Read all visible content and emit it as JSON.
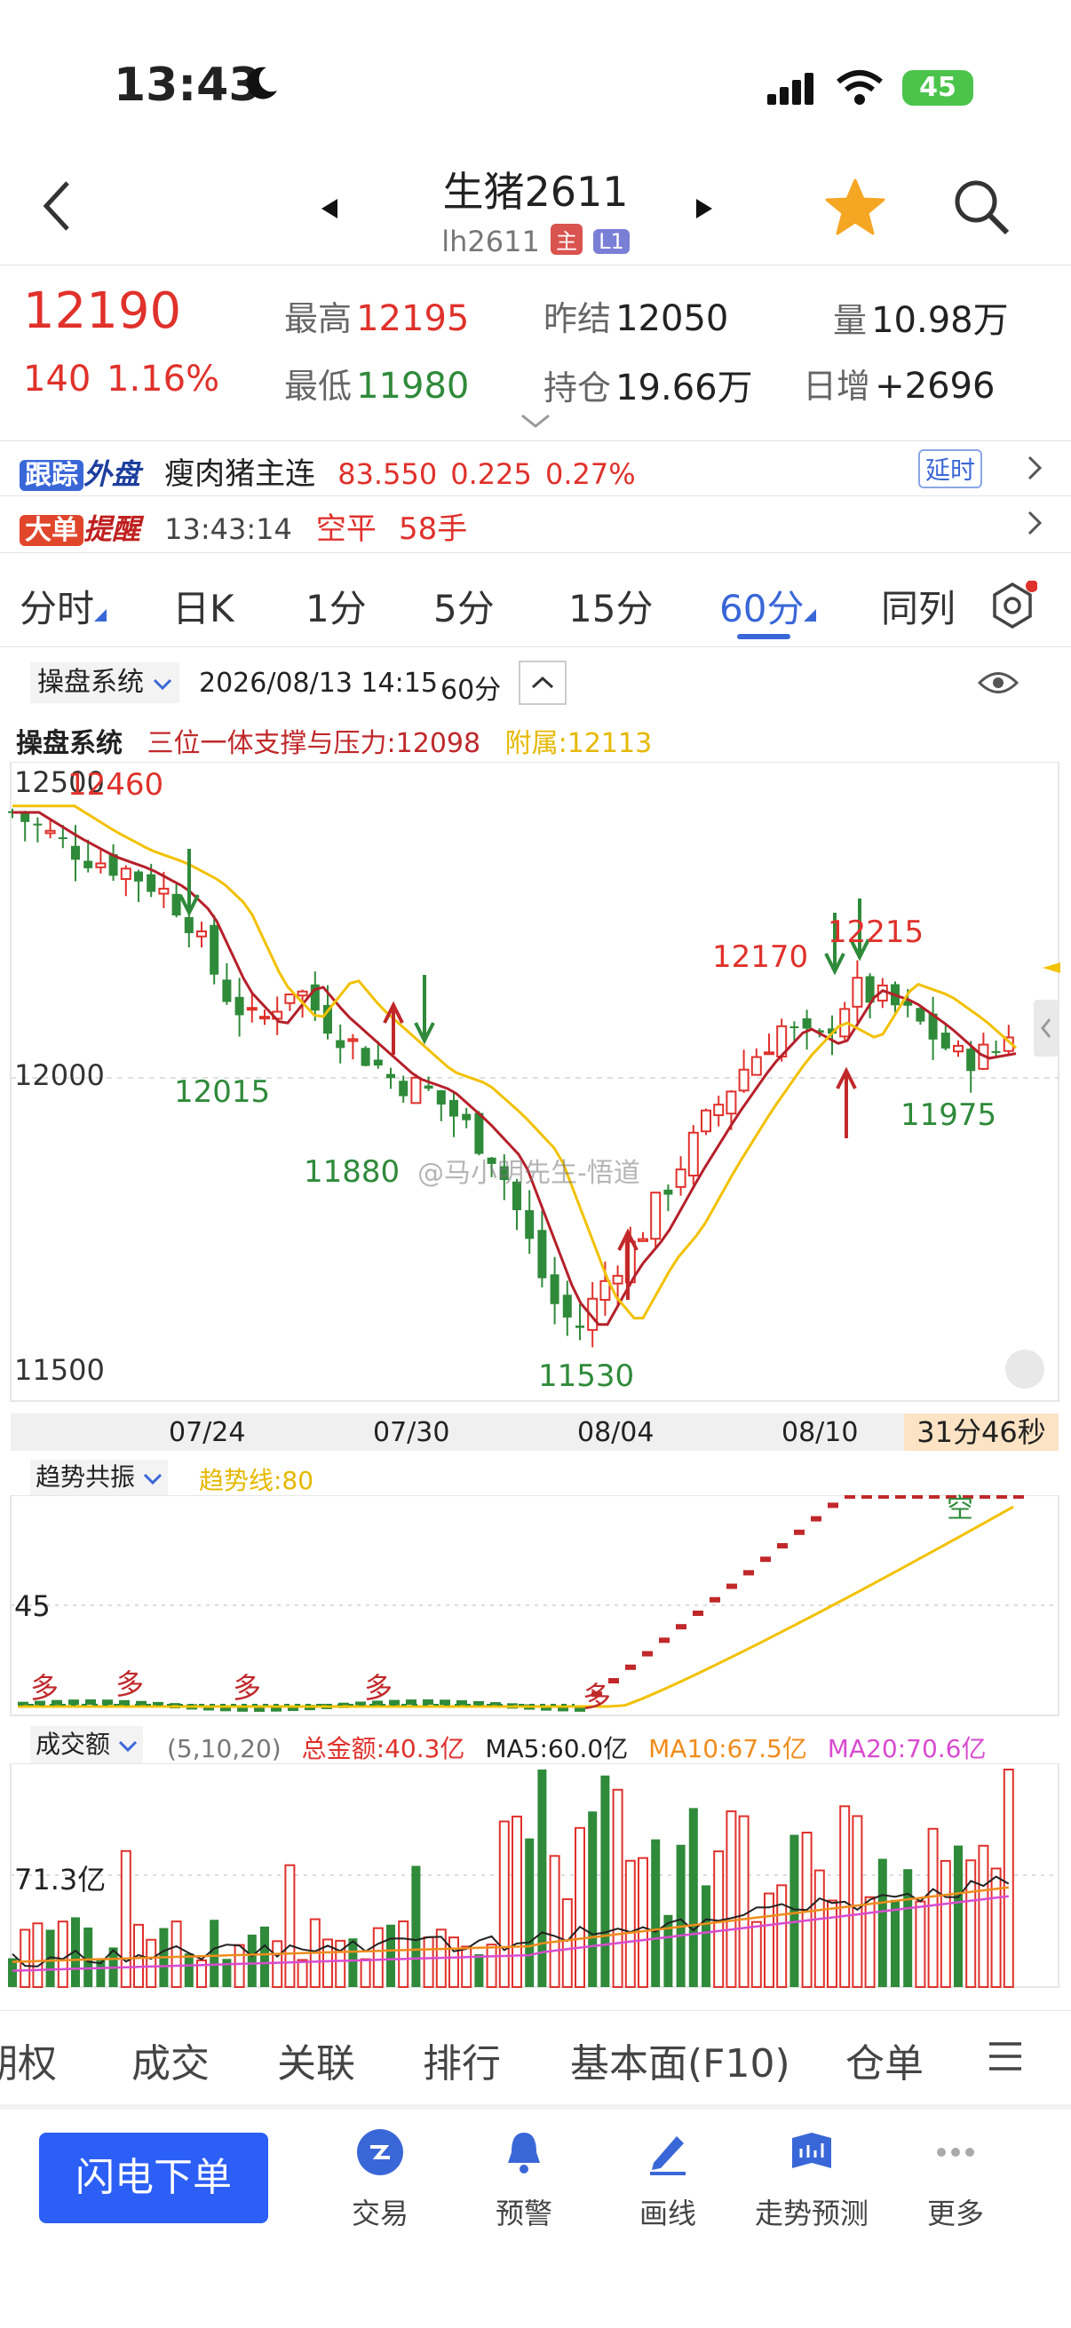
{
  "status": {
    "time": "13:43",
    "battery": "45"
  },
  "header": {
    "title": "生猪2611",
    "code": "lh2611",
    "badge_main": "主",
    "badge_l1": "L1"
  },
  "quote": {
    "price": "12190",
    "change": "140",
    "change_pct": "1.16%",
    "high_label": "最高",
    "high": "12195",
    "low_label": "最低",
    "low": "11980",
    "prev_settle_label": "昨结",
    "prev_settle": "12050",
    "open_interest_label": "持仓",
    "open_interest": "19.66万",
    "volume_label": "量",
    "volume": "10.98万",
    "daily_inc_label": "日增",
    "daily_inc": "+2696"
  },
  "tracking": {
    "tag1": "跟踪",
    "tag2": "外盘",
    "name": "瘦肉猪主连",
    "price": "83.550",
    "chg": "0.225",
    "pct": "0.27%",
    "delay": "延时"
  },
  "bigorder": {
    "tag1": "大单",
    "tag2": "提醒",
    "time": "13:43:14",
    "action": "空平",
    "qty": "58手"
  },
  "tabs": [
    "分时",
    "日K",
    "1分",
    "5分",
    "15分",
    "60分",
    "同列"
  ],
  "chart_header": {
    "system": "操盘系统",
    "datetime": "2026/08/13 14:15",
    "period": "60分"
  },
  "indicator_line": {
    "name": "操盘系统",
    "label": "三位一体支撑与压力:12098",
    "aux": "附属:12113"
  },
  "price_axis": {
    "top": "12500",
    "mid": "12000",
    "bottom": "11500"
  },
  "annotations": {
    "a12460": "12460",
    "a12015": "12015",
    "a11880": "11880",
    "a11530": "11530",
    "a12170": "12170",
    "a12215": "12215",
    "a11975": "11975"
  },
  "watermark": "@马小明先生-悟道",
  "dates": [
    "07/24",
    "07/30",
    "08/04",
    "08/10"
  ],
  "countdown": "31分46秒",
  "trend": {
    "name": "趋势共振",
    "line_label": "趋势线:80",
    "axis": "45",
    "duo": "多",
    "kong": "空"
  },
  "volume_panel": {
    "name": "成交额",
    "params": "(5,10,20)",
    "total": "总金额:40.3亿",
    "ma5": "MA5:60.0亿",
    "ma10": "MA10:67.5亿",
    "ma20": "MA20:70.6亿",
    "axis": "71.3亿"
  },
  "bottom_tabs": [
    "期权",
    "成交",
    "关联",
    "排行",
    "基本面(F10)",
    "仓单"
  ],
  "order_button": "闪电下单",
  "nav": [
    "交易",
    "预警",
    "画线",
    "走势预测",
    "更多"
  ],
  "colors": {
    "up": "#e0312b",
    "down": "#2f8a3a",
    "accent": "#3a67d8",
    "ma_yellow": "#f2c100",
    "ma_red": "#b5202a"
  }
}
